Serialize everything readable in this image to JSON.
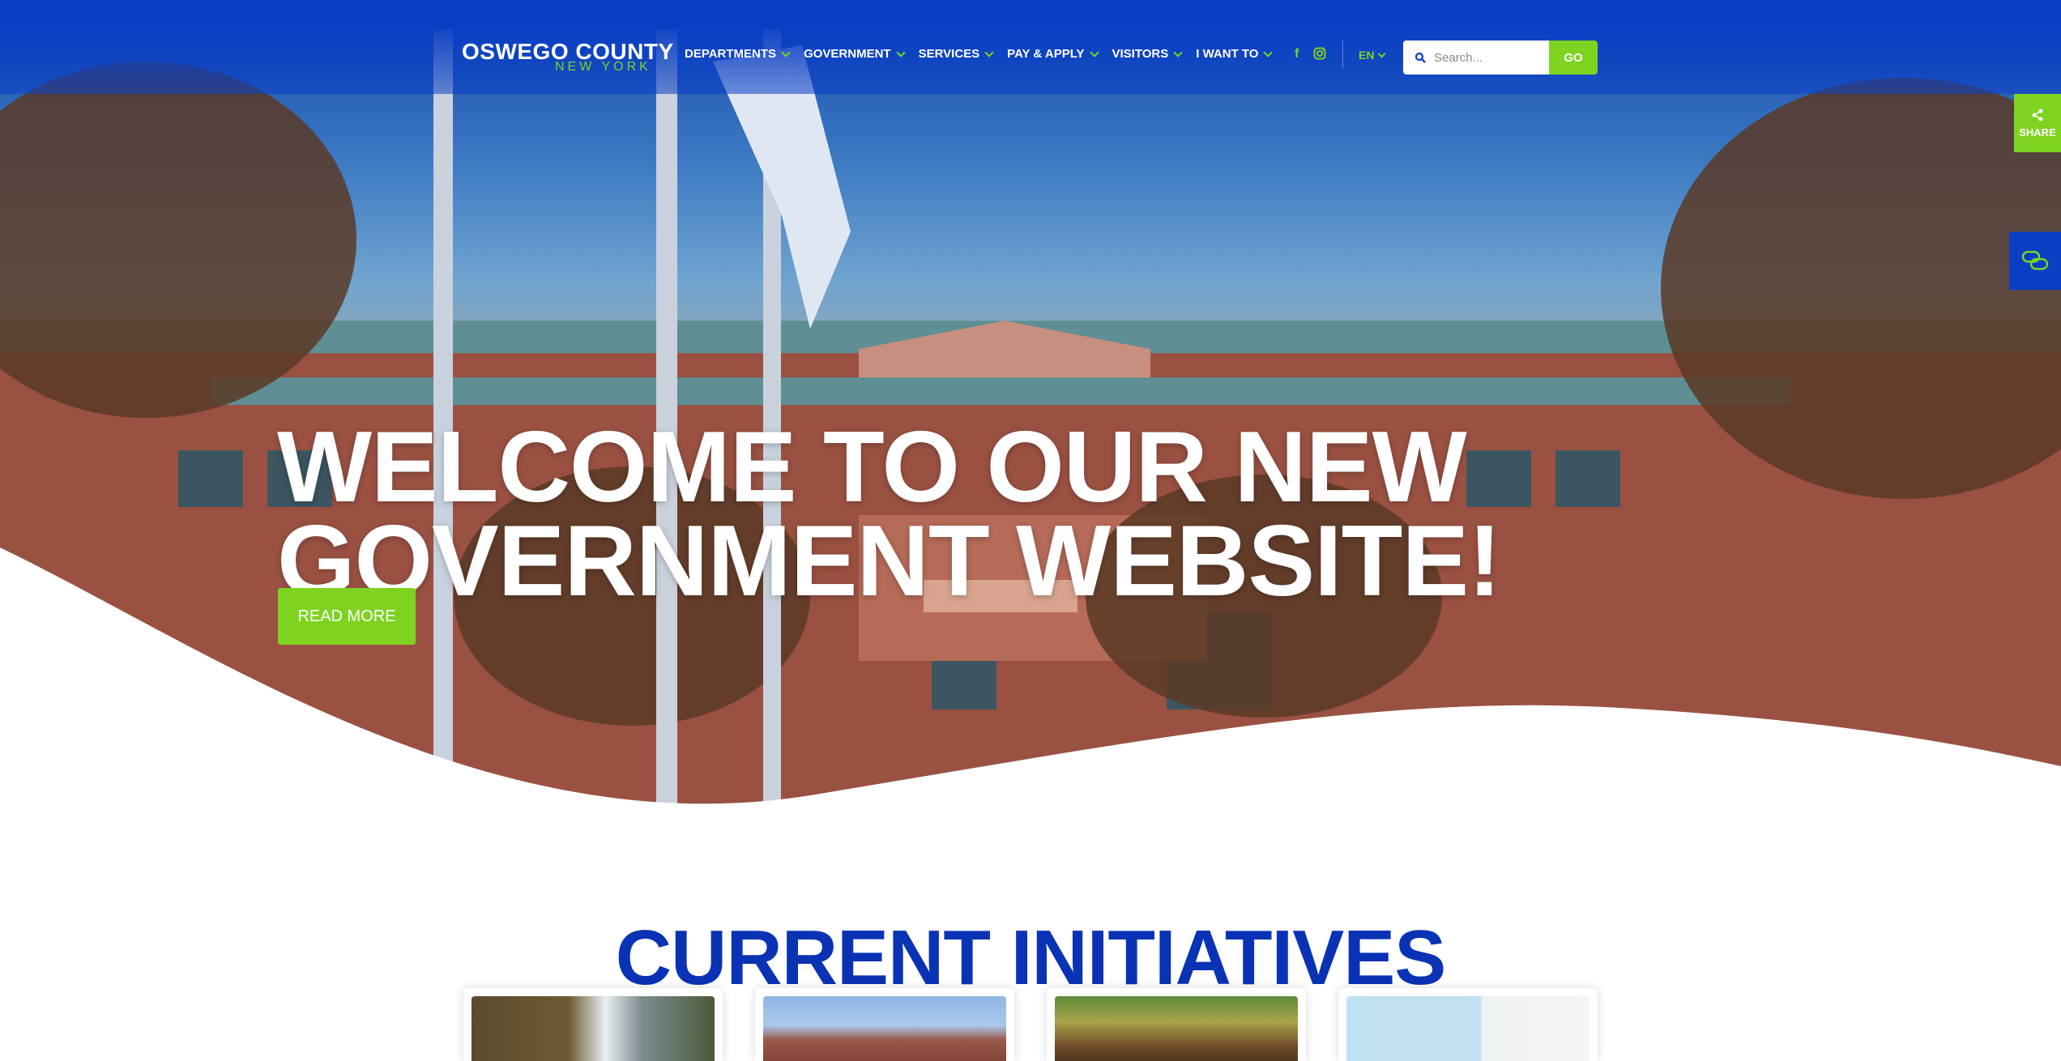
{
  "site": {
    "logo_title": "OSWEGO COUNTY",
    "logo_subtitle": "NEW YORK"
  },
  "nav": {
    "items": [
      {
        "label": "DEPARTMENTS"
      },
      {
        "label": "GOVERNMENT"
      },
      {
        "label": "SERVICES"
      },
      {
        "label": "PAY & APPLY"
      },
      {
        "label": "VISITORS"
      },
      {
        "label": "I WANT TO"
      }
    ]
  },
  "social": {
    "facebook_icon": "f",
    "instagram_icon": "instagram-icon"
  },
  "language": {
    "selected": "EN"
  },
  "search": {
    "placeholder": "Search...",
    "go_label": "GO"
  },
  "share": {
    "label": "SHARE"
  },
  "hero": {
    "headline": "WELCOME TO OUR NEW GOVERNMENT WEBSITE!",
    "button_label": "READ MORE"
  },
  "initiatives": {
    "title": "CURRENT INITIATIVES"
  },
  "colors": {
    "brand_blue": "#0a3fc4",
    "accent_green": "#7ed321",
    "title_blue": "#0a32b4"
  }
}
